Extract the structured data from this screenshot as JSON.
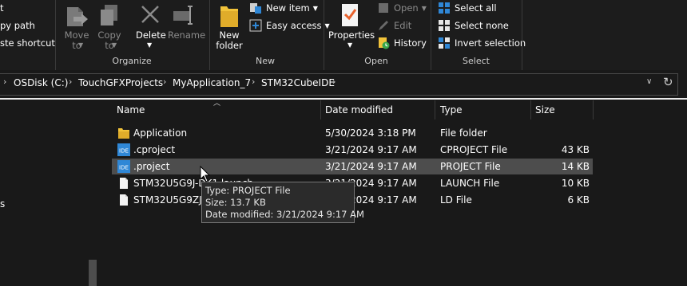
{
  "ribbon": {
    "clipboard_partial": {
      "item1": "t",
      "item2": "py path",
      "item3": "ste shortcut"
    },
    "organize": {
      "label": "Organize",
      "move_to": [
        "Move",
        "to"
      ],
      "copy_to": [
        "Copy",
        "to"
      ],
      "delete": "Delete",
      "rename": "Rename"
    },
    "new": {
      "label": "New",
      "new_folder": [
        "New",
        "folder"
      ],
      "new_item": "New item",
      "easy_access": "Easy access"
    },
    "open": {
      "label": "Open",
      "properties": "Properties",
      "open": "Open",
      "edit": "Edit",
      "history": "History"
    },
    "select": {
      "label": "Select",
      "select_all": "Select all",
      "select_none": "Select none",
      "invert_selection": "Invert selection"
    }
  },
  "address": {
    "crumbs": [
      "OSDisk (C:)",
      "TouchGFXProjects",
      "MyApplication_7",
      "STM32CubeIDE"
    ]
  },
  "columns": {
    "name": "Name",
    "date": "Date modified",
    "type": "Type",
    "size": "Size"
  },
  "files": [
    {
      "name": "Application",
      "date": "5/30/2024 3:18 PM",
      "type": "File folder",
      "size": "",
      "icon": "folder-icon"
    },
    {
      "name": ".cproject",
      "date": "3/21/2024 9:17 AM",
      "type": "CPROJECT File",
      "size": "43 KB",
      "icon": "ide-file-icon"
    },
    {
      "name": ".project",
      "date": "3/21/2024 9:17 AM",
      "type": "PROJECT File",
      "size": "14 KB",
      "icon": "ide-file-icon"
    },
    {
      "name": "STM32U5G9J-DK1.launch",
      "date": "3/21/2024 9:17 AM",
      "type": "LAUNCH File",
      "size": "10 KB",
      "icon": "document-icon"
    },
    {
      "name": "STM32U5G9ZJTX_FLASH.ld",
      "date": "3/21/2024 9:17 AM",
      "type": "LD File",
      "size": "6 KB",
      "icon": "document-icon"
    }
  ],
  "tooltip": {
    "type": "Type: PROJECT File",
    "size": "Size: 13.7 KB",
    "date": "Date modified: 3/21/2024 9:17 AM"
  },
  "sidebar": {
    "partial_letter": "s"
  },
  "colors": {
    "background": "#191919",
    "selected_row": "#4d4d4d",
    "folder": "#f2c33a",
    "ide_blue": "#2f87d6",
    "accent_orange": "#e8612c"
  }
}
